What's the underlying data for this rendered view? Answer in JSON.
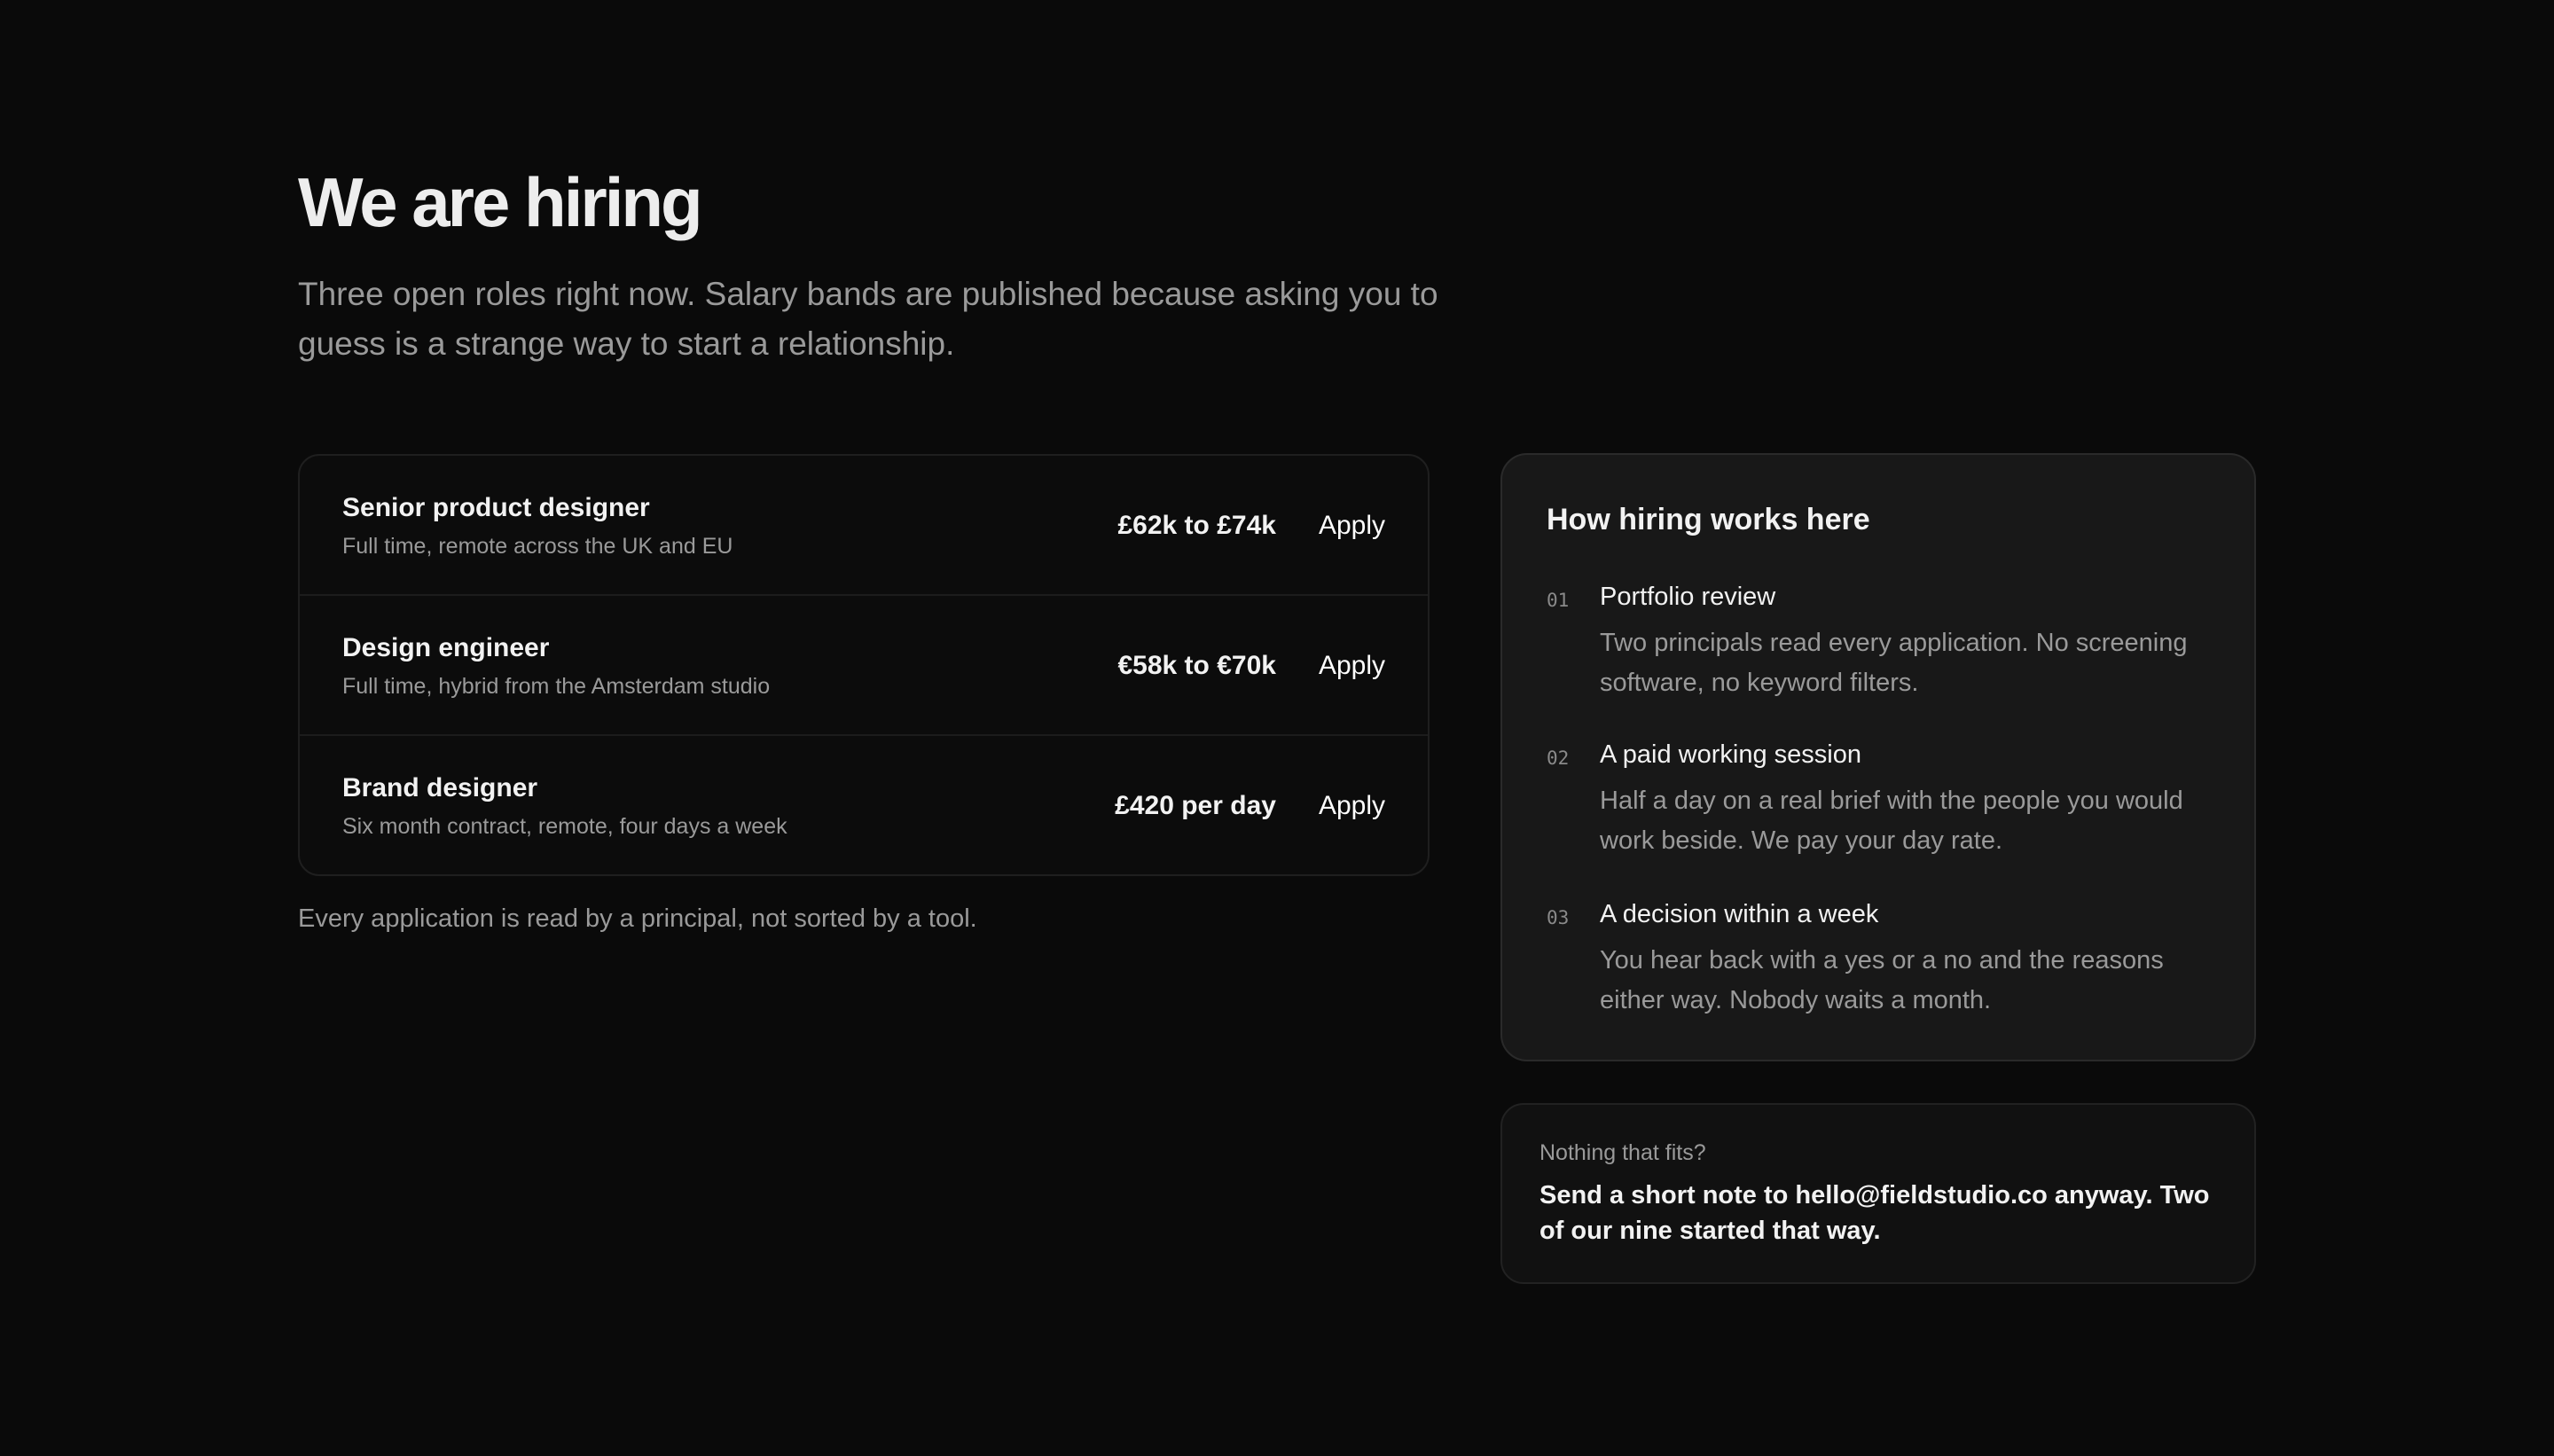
{
  "hero": {
    "title": "We are hiring",
    "subtitle": "Three open roles right now. Salary bands are published because asking you to guess is a strange way to start a relationship."
  },
  "roles": [
    {
      "title": "Senior product designer",
      "meta": "Full time, remote across the UK and EU",
      "salary": "£62k to £74k",
      "apply_label": "Apply"
    },
    {
      "title": "Design engineer",
      "meta": "Full time, hybrid from the Amsterdam studio",
      "salary": "€58k to €70k",
      "apply_label": "Apply"
    },
    {
      "title": "Brand designer",
      "meta": "Six month contract, remote, four days a week",
      "salary": "£420 per day",
      "apply_label": "Apply"
    }
  ],
  "footnote": "Every application is read by a principal, not sorted by a tool.",
  "process": {
    "title": "How hiring works here",
    "steps": [
      {
        "num": "01",
        "title": "Portfolio review",
        "desc": "Two principals read every application. No screening software, no keyword filters."
      },
      {
        "num": "02",
        "title": "A paid working session",
        "desc": "Half a day on a real brief with the people you would work beside. We pay your day rate."
      },
      {
        "num": "03",
        "title": "A decision within a week",
        "desc": "You hear back with a yes or a no and the reasons either way. Nobody waits a month."
      }
    ]
  },
  "cta": {
    "label": "Nothing that fits?",
    "text": "Send a short note to hello@fieldstudio.co anyway. Two of our nine started that way."
  },
  "colors": {
    "background": "#0a0a0a",
    "card": "#181818",
    "text_primary": "#f2f2f2",
    "text_muted": "#9a9a9a"
  }
}
